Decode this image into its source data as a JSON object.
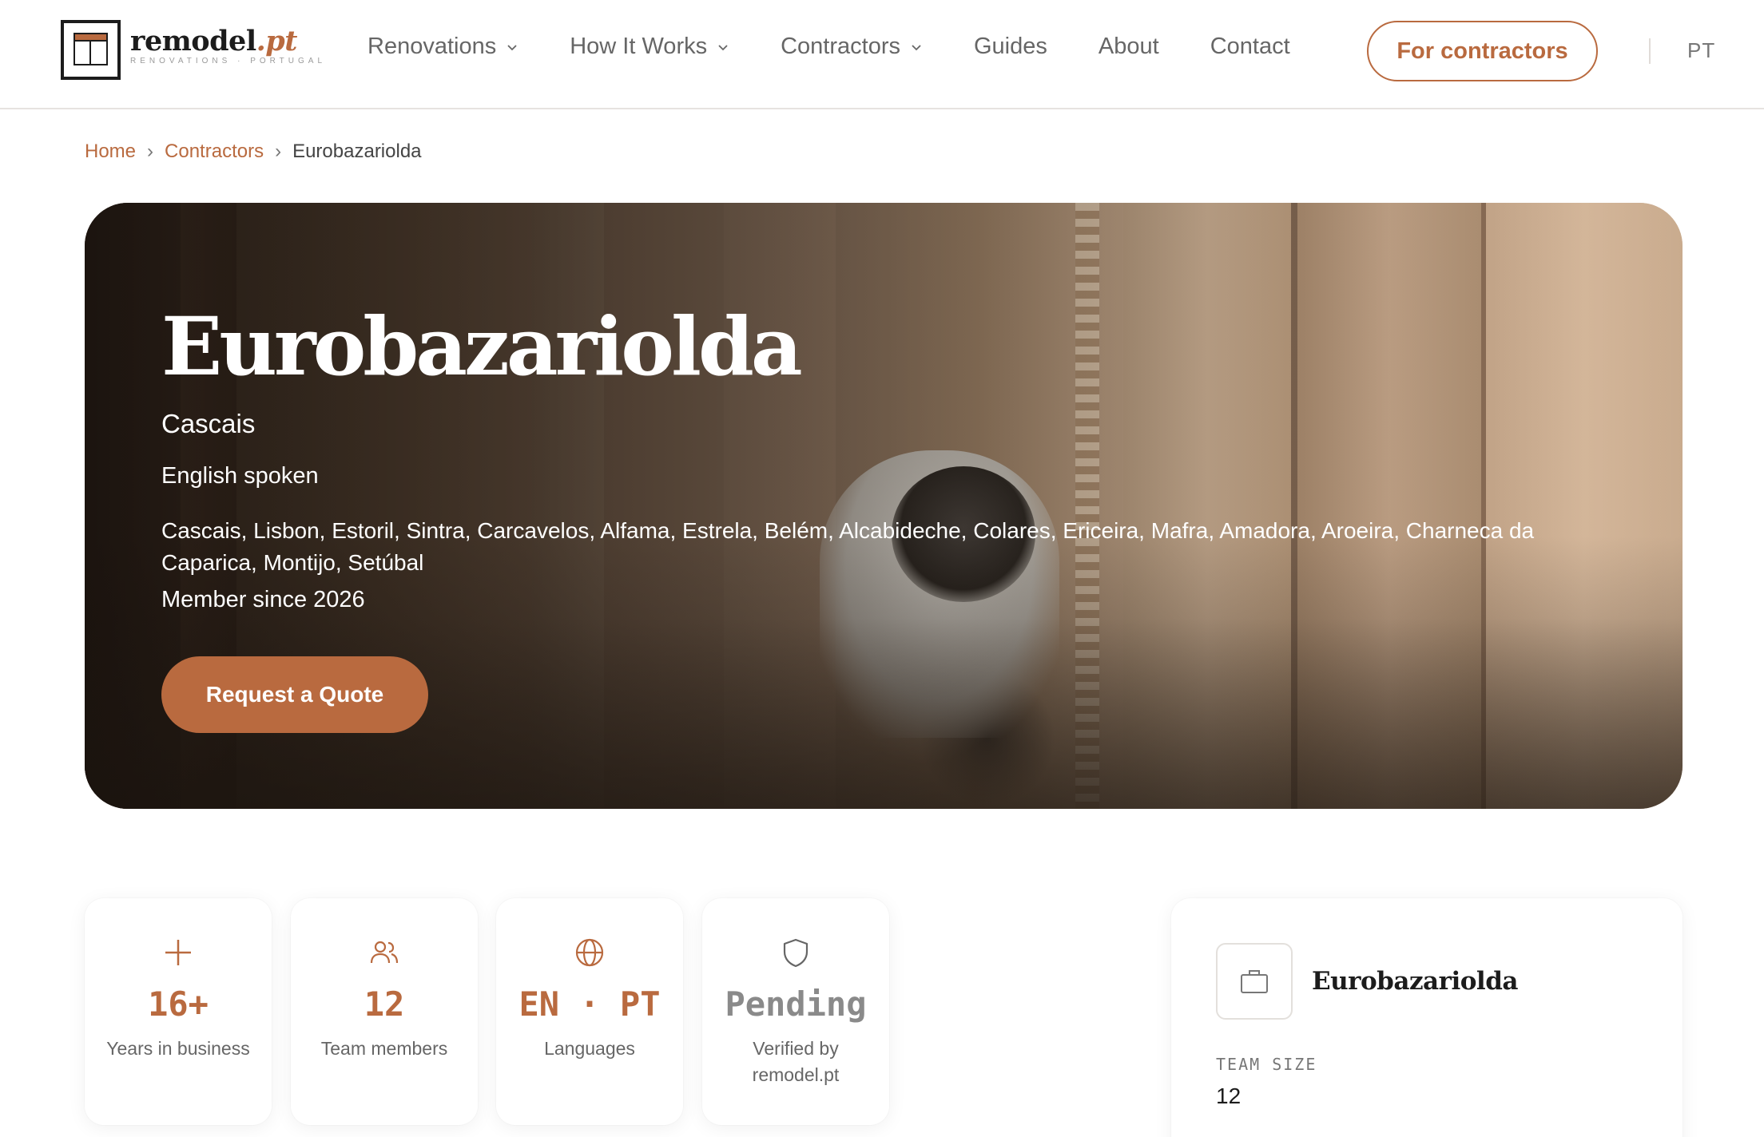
{
  "brand": {
    "name": "remodel",
    "tld": ".pt",
    "tagline": "RENOVATIONS · PORTUGAL",
    "accent_color": "#b96a3f"
  },
  "nav": {
    "items": [
      {
        "label": "Renovations",
        "has_dropdown": true
      },
      {
        "label": "How It Works",
        "has_dropdown": true
      },
      {
        "label": "Contractors",
        "has_dropdown": true
      },
      {
        "label": "Guides",
        "has_dropdown": false
      },
      {
        "label": "About",
        "has_dropdown": false
      },
      {
        "label": "Contact",
        "has_dropdown": false
      }
    ],
    "cta_label": "For contractors",
    "language": "PT"
  },
  "breadcrumb": {
    "home": "Home",
    "contractors": "Contractors",
    "current": "Eurobazariolda"
  },
  "hero": {
    "title": "Eurobazariolda",
    "city": "Cascais",
    "language_note": "English spoken",
    "service_areas": "Cascais, Lisbon, Estoril, Sintra, Carcavelos, Alfama, Estrela, Belém, Alcabideche, Colares, Ericeira, Mafra, Amadora, Aroeira, Charneca da Caparica, Montijo, Setúbal",
    "member_since": "Member since 2026",
    "button_label": "Request a Quote"
  },
  "stats": [
    {
      "icon": "plus-icon",
      "value": "16+",
      "label": "Years in business"
    },
    {
      "icon": "users-icon",
      "value": "12",
      "label": "Team members"
    },
    {
      "icon": "globe-icon",
      "value": "EN · PT",
      "label": "Languages"
    },
    {
      "icon": "shield-icon",
      "value": "Pending",
      "label": "Verified by remodel.pt"
    }
  ],
  "side_card": {
    "icon": "briefcase-icon",
    "name": "Eurobazariolda",
    "team_size_label": "TEAM SIZE",
    "team_size_value": "12"
  }
}
